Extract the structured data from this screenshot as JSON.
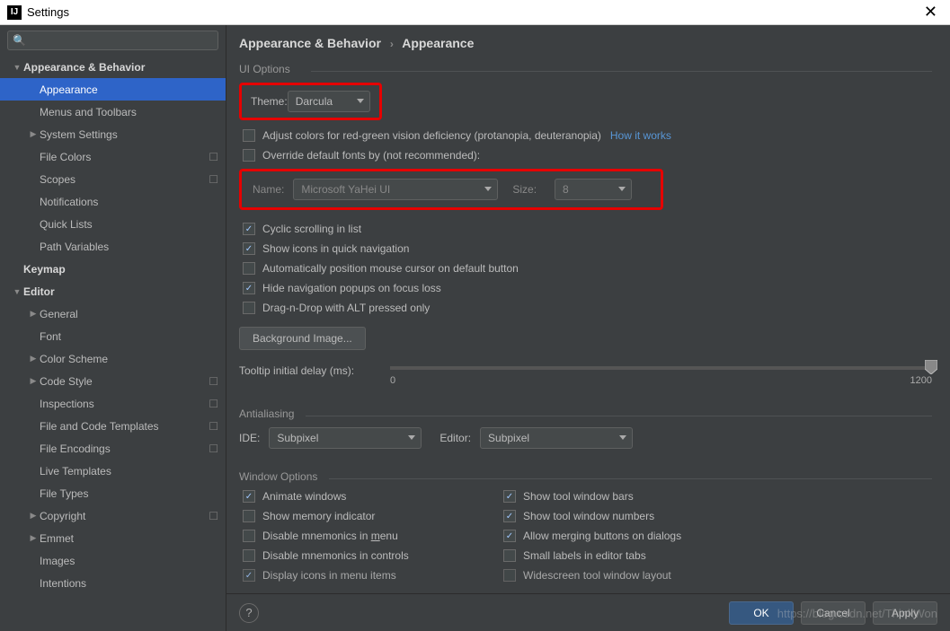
{
  "window": {
    "title": "Settings"
  },
  "search": {
    "placeholder": ""
  },
  "sidebar": {
    "items": [
      {
        "label": "Appearance & Behavior",
        "depth": 0,
        "bold": true,
        "arrow": "down"
      },
      {
        "label": "Appearance",
        "depth": 1,
        "selected": true
      },
      {
        "label": "Menus and Toolbars",
        "depth": 1
      },
      {
        "label": "System Settings",
        "depth": 1,
        "arrow": "right"
      },
      {
        "label": "File Colors",
        "depth": 1,
        "badge": true
      },
      {
        "label": "Scopes",
        "depth": 1,
        "badge": true
      },
      {
        "label": "Notifications",
        "depth": 1
      },
      {
        "label": "Quick Lists",
        "depth": 1
      },
      {
        "label": "Path Variables",
        "depth": 1
      },
      {
        "label": "Keymap",
        "depth": 0,
        "bold": true
      },
      {
        "label": "Editor",
        "depth": 0,
        "bold": true,
        "arrow": "down"
      },
      {
        "label": "General",
        "depth": 1,
        "arrow": "right"
      },
      {
        "label": "Font",
        "depth": 1
      },
      {
        "label": "Color Scheme",
        "depth": 1,
        "arrow": "right"
      },
      {
        "label": "Code Style",
        "depth": 1,
        "arrow": "right",
        "badge": true
      },
      {
        "label": "Inspections",
        "depth": 1,
        "badge": true
      },
      {
        "label": "File and Code Templates",
        "depth": 1,
        "badge": true
      },
      {
        "label": "File Encodings",
        "depth": 1,
        "badge": true
      },
      {
        "label": "Live Templates",
        "depth": 1
      },
      {
        "label": "File Types",
        "depth": 1
      },
      {
        "label": "Copyright",
        "depth": 1,
        "arrow": "right",
        "badge": true
      },
      {
        "label": "Emmet",
        "depth": 1,
        "arrow": "right"
      },
      {
        "label": "Images",
        "depth": 1
      },
      {
        "label": "Intentions",
        "depth": 1
      }
    ]
  },
  "breadcrumb": {
    "root": "Appearance & Behavior",
    "leaf": "Appearance"
  },
  "ui_options": {
    "section": "UI Options",
    "theme_label": "Theme:",
    "theme_value": "Darcula",
    "adjust_colors": "Adjust colors for red-green vision deficiency (protanopia, deuteranopia)",
    "how_it_works": "How it works",
    "override_fonts": "Override default fonts by (not recommended):",
    "name_label": "Name:",
    "name_value": "Microsoft YaHei UI",
    "size_label": "Size:",
    "size_value": "8",
    "cyclic": "Cyclic scrolling in list",
    "show_icons": "Show icons in quick navigation",
    "auto_mouse": "Automatically position mouse cursor on default button",
    "hide_popups": "Hide navigation popups on focus loss",
    "dragdrop": "Drag-n-Drop with ALT pressed only",
    "bg_image": "Background Image...",
    "tooltip_label": "Tooltip initial delay (ms):",
    "tooltip_min": "0",
    "tooltip_max": "1200"
  },
  "antialiasing": {
    "section": "Antialiasing",
    "ide_label": "IDE:",
    "ide_value": "Subpixel",
    "editor_label": "Editor:",
    "editor_value": "Subpixel"
  },
  "window_options": {
    "section": "Window Options",
    "left": [
      {
        "label": "Animate windows",
        "checked": true
      },
      {
        "label": "Show memory indicator",
        "checked": false
      },
      {
        "label_html": "Disable mnemonics in <u>m</u>enu",
        "checked": false
      },
      {
        "label": "Disable mnemonics in controls",
        "checked": false
      },
      {
        "label": "Display icons in menu items",
        "checked": true,
        "cut": true
      }
    ],
    "right": [
      {
        "label": "Show tool window bars",
        "checked": true
      },
      {
        "label": "Show tool window numbers",
        "checked": true
      },
      {
        "label": "Allow merging buttons on dialogs",
        "checked": true
      },
      {
        "label": "Small labels in editor tabs",
        "checked": false
      },
      {
        "label": "Widescreen tool window layout",
        "checked": false,
        "cut": true
      }
    ]
  },
  "footer": {
    "ok": "OK",
    "cancel": "Cancel",
    "apply": "Apply"
  },
  "watermark": "https://blog.csdn.net/ThinkWon"
}
